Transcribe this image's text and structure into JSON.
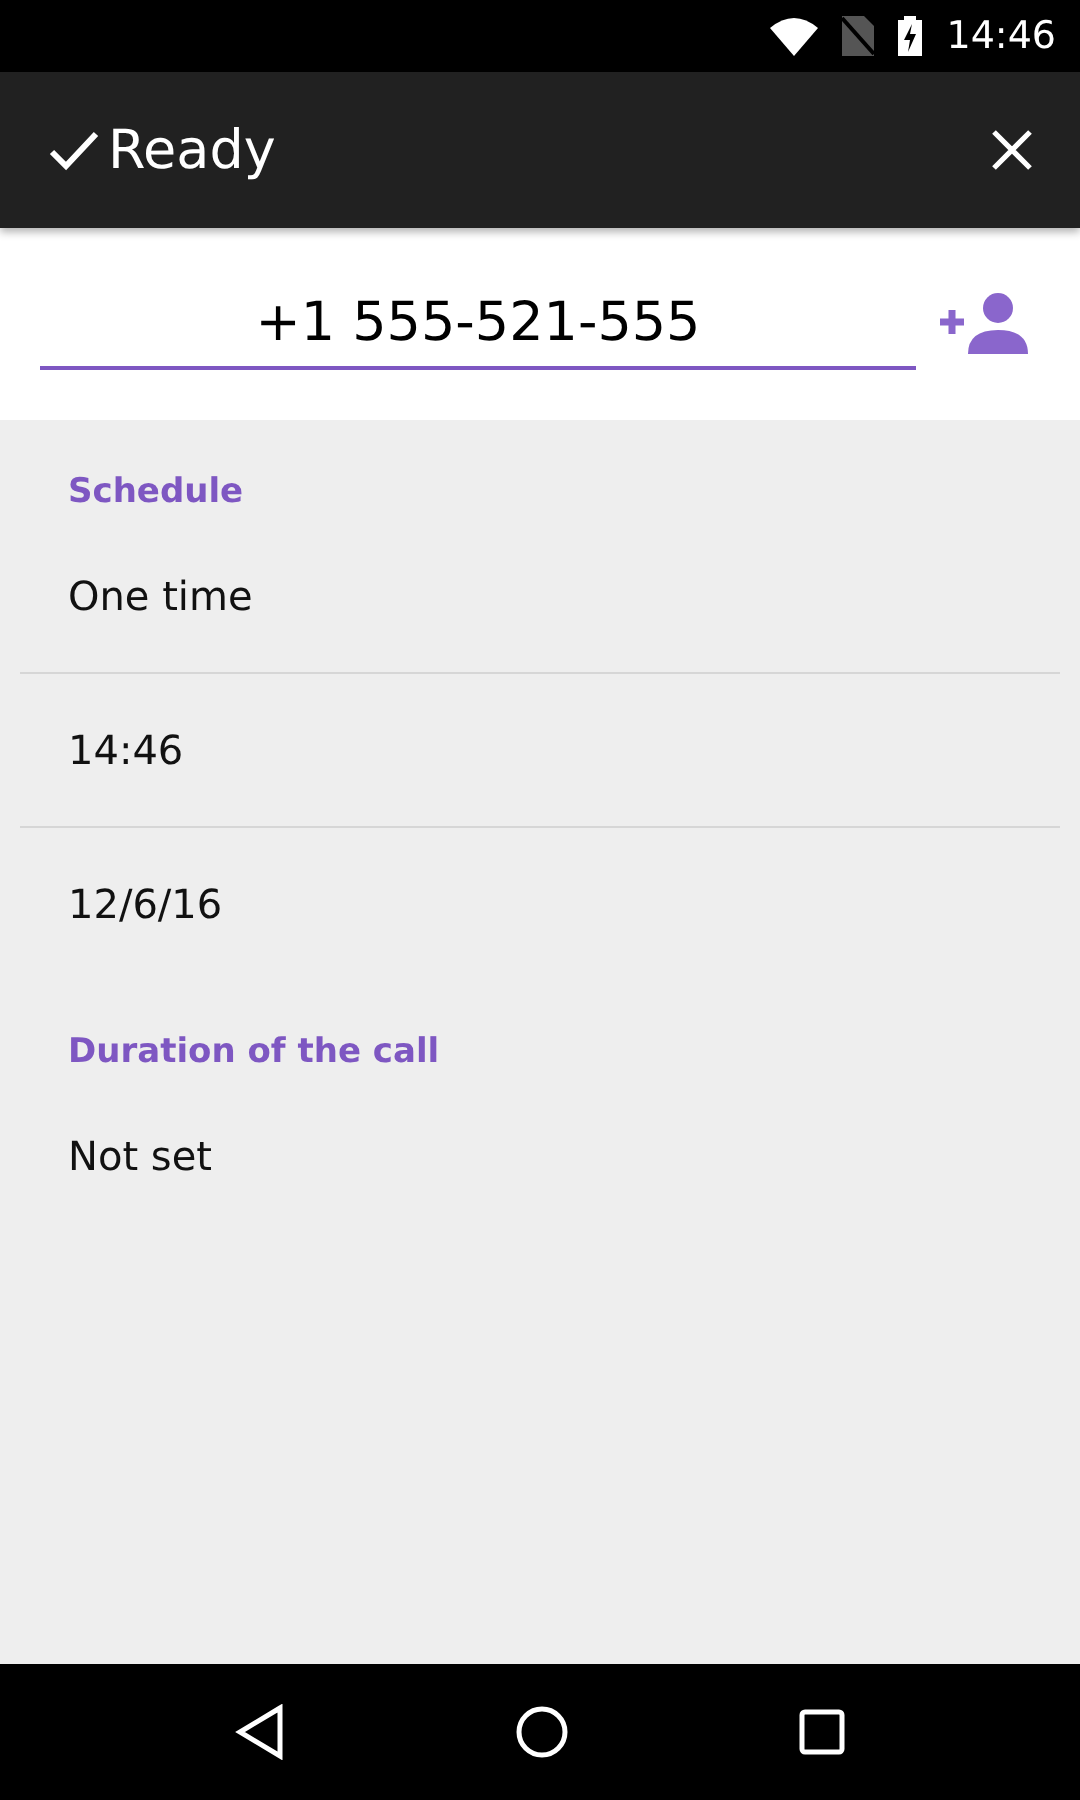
{
  "status_bar": {
    "time": "14:46"
  },
  "toolbar": {
    "title": "Ready"
  },
  "phone": {
    "value": "+1 555-521-555"
  },
  "sections": [
    {
      "title": "Schedule",
      "items": [
        "One time",
        "14:46",
        "12/6/16"
      ]
    },
    {
      "title": "Duration of the call",
      "items": [
        "Not set"
      ]
    }
  ]
}
